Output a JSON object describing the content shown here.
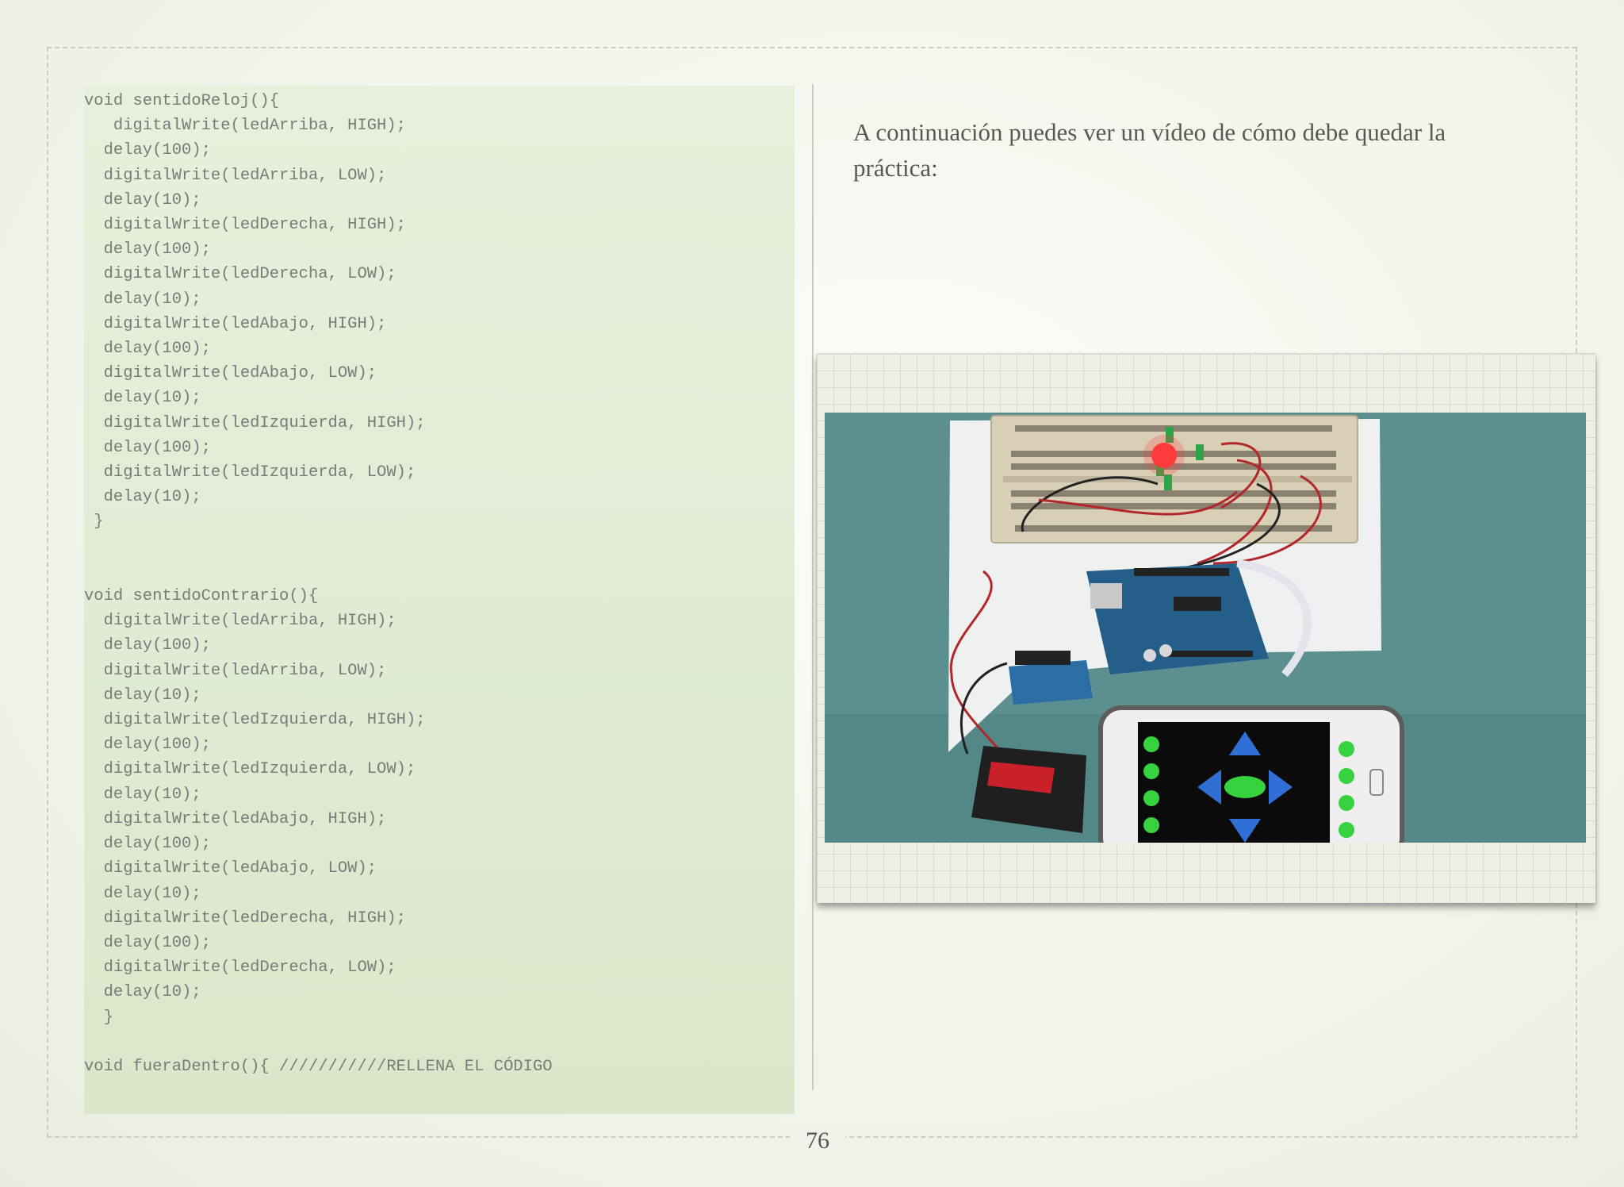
{
  "code": {
    "text": "void sentidoReloj(){\n   digitalWrite(ledArriba, HIGH);\n  delay(100);\n  digitalWrite(ledArriba, LOW);\n  delay(10);\n  digitalWrite(ledDerecha, HIGH);\n  delay(100);\n  digitalWrite(ledDerecha, LOW);\n  delay(10);\n  digitalWrite(ledAbajo, HIGH);\n  delay(100);\n  digitalWrite(ledAbajo, LOW);\n  delay(10);\n  digitalWrite(ledIzquierda, HIGH);\n  delay(100);\n  digitalWrite(ledIzquierda, LOW);\n  delay(10);\n }\n\n\nvoid sentidoContrario(){\n  digitalWrite(ledArriba, HIGH);\n  delay(100);\n  digitalWrite(ledArriba, LOW);\n  delay(10);\n  digitalWrite(ledIzquierda, HIGH);\n  delay(100);\n  digitalWrite(ledIzquierda, LOW);\n  delay(10);\n  digitalWrite(ledAbajo, HIGH);\n  delay(100);\n  digitalWrite(ledAbajo, LOW);\n  delay(10);\n  digitalWrite(ledDerecha, HIGH);\n  delay(100);\n  digitalWrite(ledDerecha, LOW);\n  delay(10);\n  }\n\nvoid fueraDentro(){ ///////////RELLENA EL CÓDIGO"
  },
  "intro": {
    "text": "A continuación puedes ver un vídeo de cómo debe quedar la práctica:"
  },
  "page": {
    "number": "76"
  }
}
